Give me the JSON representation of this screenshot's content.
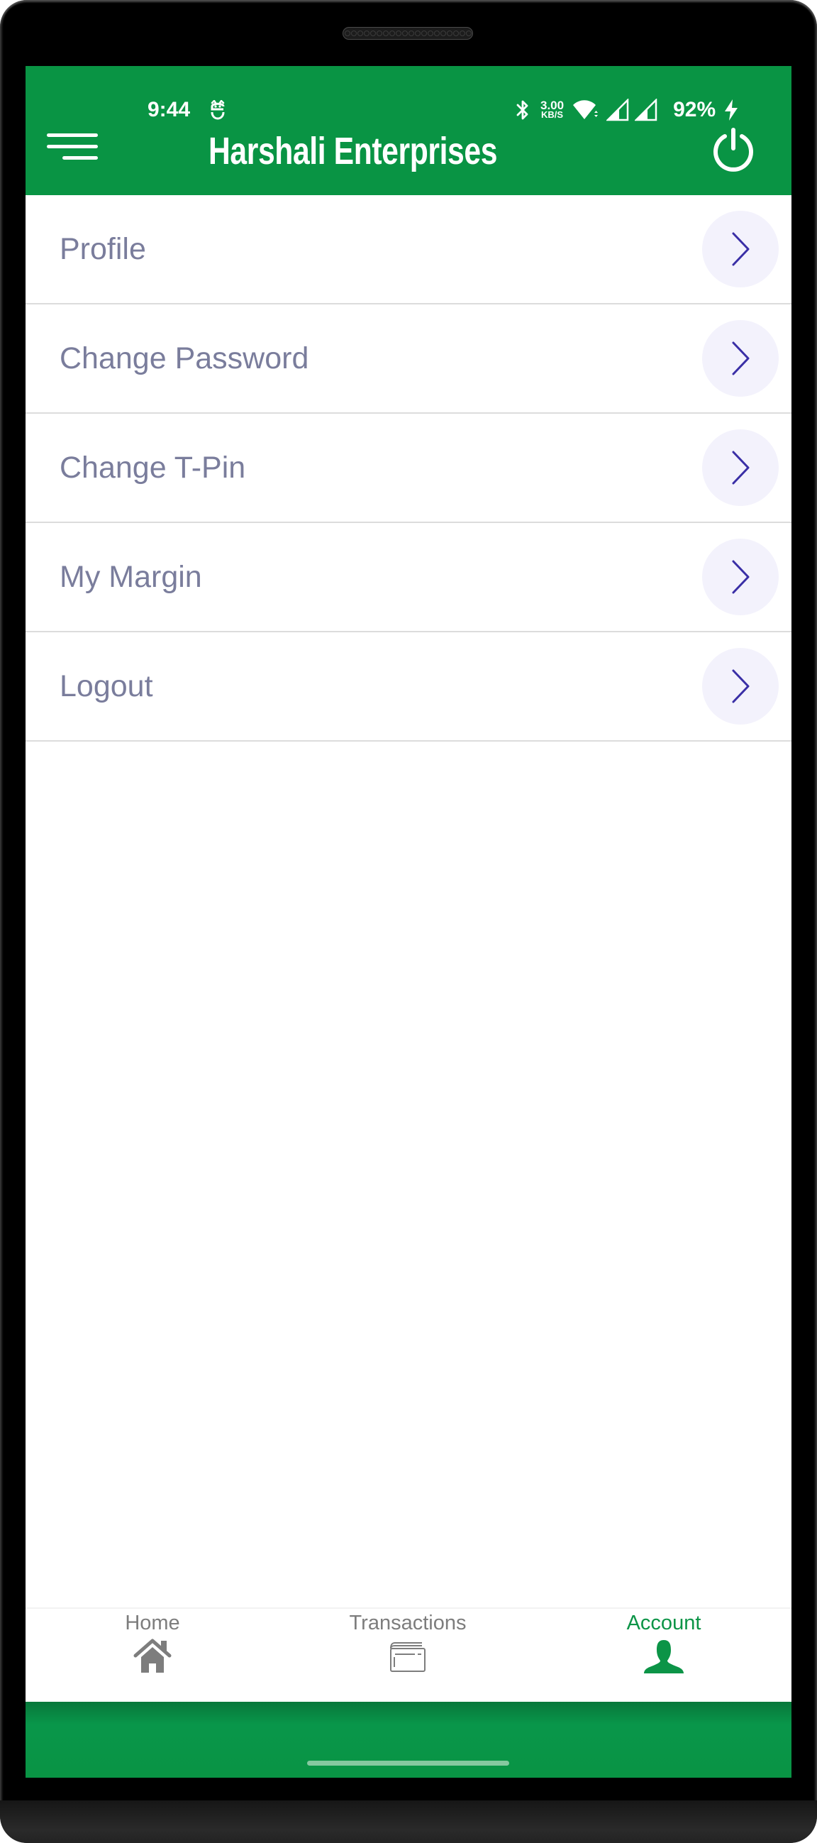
{
  "status_bar": {
    "time": "9:44",
    "app_icon": "notification-app-icon",
    "network_speed_value": "3.00",
    "network_speed_unit": "KB/S",
    "battery_percent": "92%",
    "icons": [
      "bluetooth-icon",
      "wifi-icon",
      "signal-icon",
      "signal-icon",
      "charging-bolt-icon"
    ]
  },
  "header": {
    "title": "Harshali Enterprises",
    "menu_icon": "hamburger-menu-icon",
    "power_icon": "power-icon"
  },
  "menu": {
    "items": [
      {
        "label": "Profile",
        "icon": "chevron-right-icon"
      },
      {
        "label": "Change Password",
        "icon": "chevron-right-icon"
      },
      {
        "label": "Change T-Pin",
        "icon": "chevron-right-icon"
      },
      {
        "label": "My Margin",
        "icon": "chevron-right-icon"
      },
      {
        "label": "Logout",
        "icon": "chevron-right-icon"
      }
    ]
  },
  "bottom_nav": {
    "items": [
      {
        "label": "Home",
        "icon": "home-icon",
        "active": false
      },
      {
        "label": "Transactions",
        "icon": "transactions-card-icon",
        "active": false
      },
      {
        "label": "Account",
        "icon": "account-person-icon",
        "active": true
      }
    ]
  },
  "colors": {
    "brand_green": "#099444",
    "menu_text": "#7a7d9c",
    "chevron": "#3a2fa6",
    "chevron_bg": "#f3f2fc",
    "nav_inactive": "#7d7d7d",
    "nav_active": "#0c9447"
  }
}
